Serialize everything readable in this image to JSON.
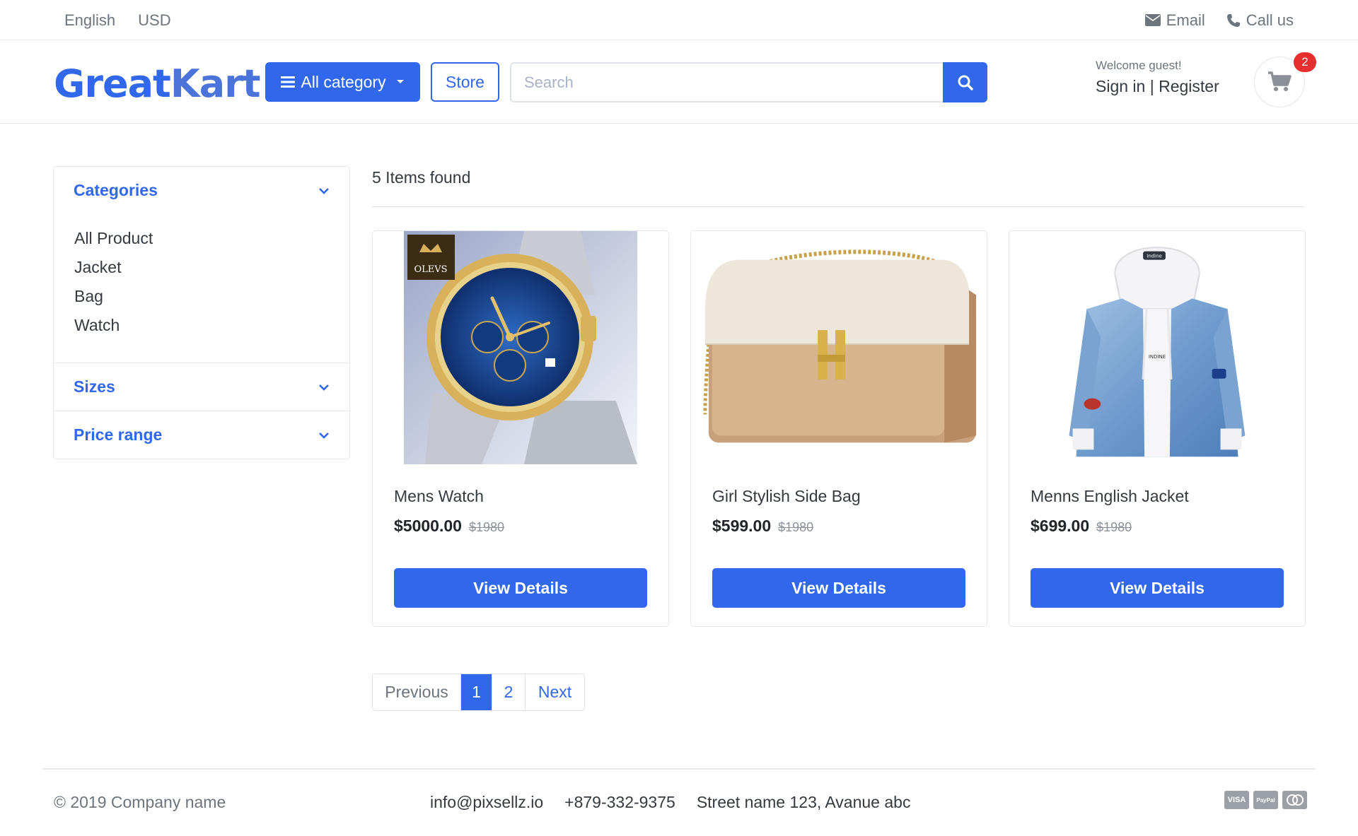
{
  "topbar": {
    "language": "English",
    "currency": "USD",
    "email_label": "Email",
    "call_label": "Call us"
  },
  "header": {
    "logo_part1": "Great",
    "logo_part2": "Kart",
    "category_button": "All category",
    "store_button": "Store",
    "search_placeholder": "Search",
    "welcome_text": "Welcome guest!",
    "signin_label": "Sign in",
    "register_label": "Register",
    "cart_count": "2"
  },
  "sidebar": {
    "categories_title": "Categories",
    "categories": [
      "All Product",
      "Jacket",
      "Bag",
      "Watch"
    ],
    "sizes_title": "Sizes",
    "price_range_title": "Price range"
  },
  "main": {
    "items_found": "5 Items found",
    "products": [
      {
        "title": "Mens Watch",
        "price": "$5000.00",
        "old_price": "$1980",
        "button": "View Details",
        "brand_mark": "OLEVS"
      },
      {
        "title": "Girl Stylish Side Bag",
        "price": "$599.00",
        "old_price": "$1980",
        "button": "View Details"
      },
      {
        "title": "Menns English Jacket",
        "price": "$699.00",
        "old_price": "$1980",
        "button": "View Details",
        "brand_mark": "INDINE"
      }
    ]
  },
  "pagination": {
    "previous": "Previous",
    "pages": [
      "1",
      "2"
    ],
    "active_page": "1",
    "next": "Next"
  },
  "footer": {
    "copyright": "© 2019 Company name",
    "email": "info@pixsellz.io",
    "phone": "+879-332-9375",
    "address": "Street name 123, Avanue abc",
    "payment_icons": [
      "visa-icon",
      "paypal-icon",
      "mastercard-icon"
    ]
  },
  "colors": {
    "primary": "#3167eb",
    "badge": "#e62e2e",
    "muted": "#6c757d"
  }
}
